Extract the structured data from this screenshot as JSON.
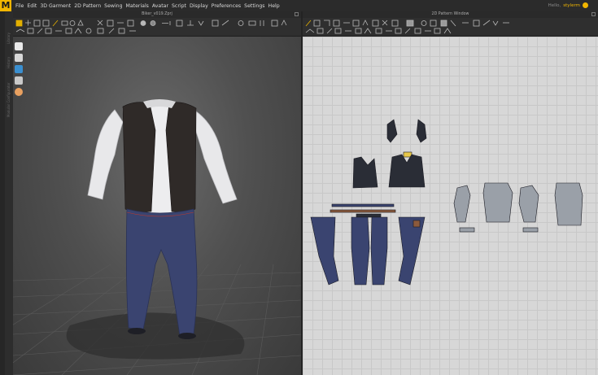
{
  "app": {
    "logo_letter": "M",
    "menu": [
      "File",
      "Edit",
      "3D Garment",
      "2D Pattern",
      "Sewing",
      "Materials",
      "Avatar",
      "Script",
      "Display",
      "Preferences",
      "Settings",
      "Help"
    ],
    "user_prefix": "Hello,",
    "user_name": "stylerm"
  },
  "window3d": {
    "title": "Biker_v019.Zprj"
  },
  "window2d": {
    "title": "2D Pattern Window"
  },
  "side_labels": [
    "Library",
    "History",
    "Modular Configurator"
  ],
  "colors": {
    "accent": "#f2b600",
    "pattern_dark": "#2a2d36",
    "pattern_denim": "#3a4470",
    "pattern_grey": "#9aa0a8"
  }
}
